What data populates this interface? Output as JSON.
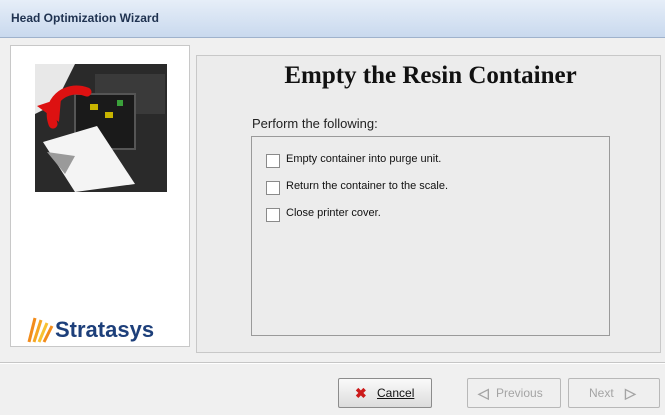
{
  "window": {
    "title": "Head Optimization Wizard"
  },
  "brand": {
    "name": "Stratasys"
  },
  "page": {
    "title": "Empty the Resin Container",
    "instruction": "Perform the following:"
  },
  "checklist": [
    {
      "label": "Empty container into purge unit.",
      "checked": false
    },
    {
      "label": "Return the container to the scale.",
      "checked": false
    },
    {
      "label": "Close printer cover.",
      "checked": false
    }
  ],
  "buttons": {
    "cancel": {
      "label": "Cancel",
      "icon": "x-icon",
      "color": "#cc1a1a"
    },
    "previous": {
      "label": "Previous",
      "icon": "arrow-left-icon",
      "enabled": false
    },
    "next": {
      "label": "Next",
      "icon": "arrow-right-icon",
      "enabled": false
    }
  }
}
